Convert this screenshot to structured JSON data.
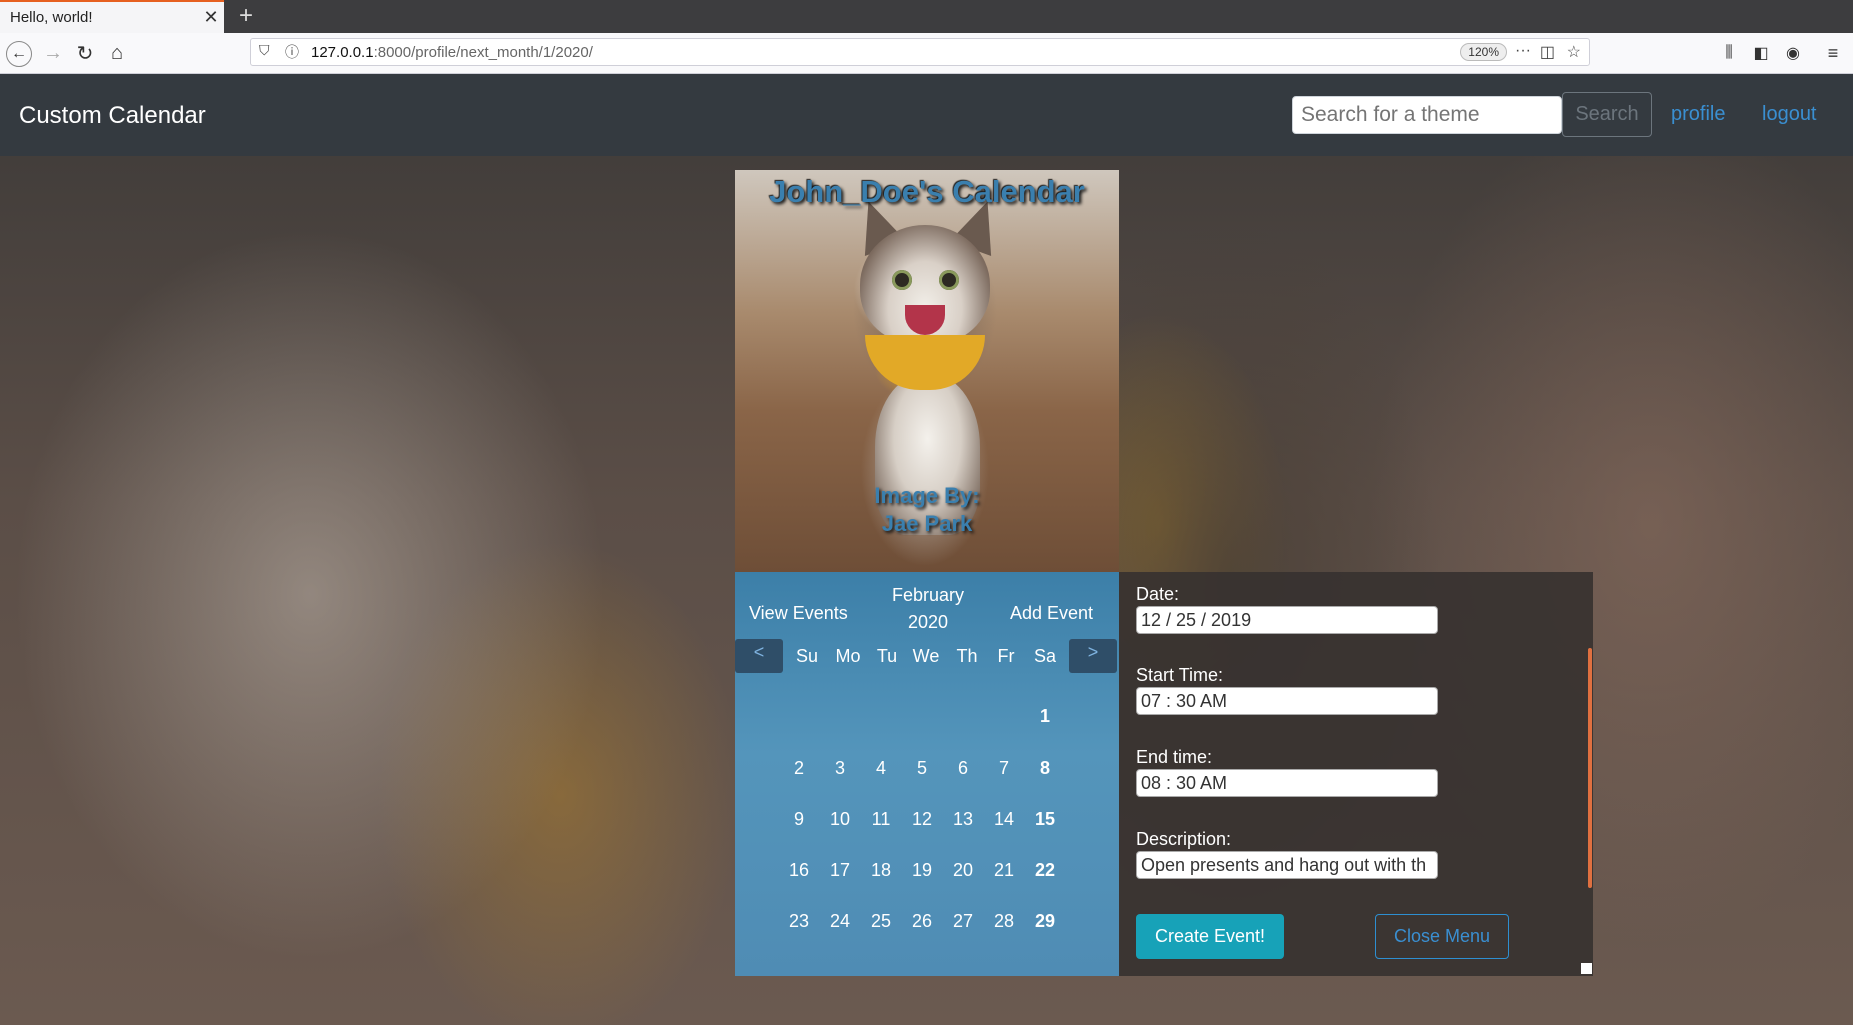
{
  "browser": {
    "tab_title": "Hello, world!",
    "url_host": "127.0.0.1",
    "url_path": ":8000/profile/next_month/1/2020/",
    "zoom": "120%"
  },
  "header": {
    "brand": "Custom Calendar",
    "search_placeholder": "Search for a theme",
    "search_button": "Search",
    "profile_link": "profile",
    "logout_link": "logout"
  },
  "calendar": {
    "title": "John_Doe's Calendar",
    "credit_line1": "Image By:",
    "credit_line2": "Jae Park",
    "view_events": "View Events",
    "add_event": "Add Event",
    "month": "February",
    "year": "2020",
    "prev": "<",
    "next": ">",
    "weekdays": [
      "Su",
      "Mo",
      "Tu",
      "We",
      "Th",
      "Fr",
      "Sa"
    ],
    "weeks": [
      [
        "",
        "",
        "",
        "",
        "",
        "",
        "1"
      ],
      [
        "2",
        "3",
        "4",
        "5",
        "6",
        "7",
        "8"
      ],
      [
        "9",
        "10",
        "11",
        "12",
        "13",
        "14",
        "15"
      ],
      [
        "16",
        "17",
        "18",
        "19",
        "20",
        "21",
        "22"
      ],
      [
        "23",
        "24",
        "25",
        "26",
        "27",
        "28",
        "29"
      ]
    ]
  },
  "event_form": {
    "date_label": "Date:",
    "date_value": "12 / 25 / 2019",
    "start_label": "Start Time:",
    "start_value": "07 : 30  AM",
    "end_label": "End time:",
    "end_value": "08 : 30  AM",
    "description_label": "Description:",
    "description_value": "Open presents and hang out with th",
    "create_button": "Create Event!",
    "close_button": "Close Menu"
  },
  "colors": {
    "header_bg": "#343a40",
    "link": "#3a8fd1",
    "create_button": "#17a2b8",
    "calendar_panel": "#4f8cb4"
  }
}
